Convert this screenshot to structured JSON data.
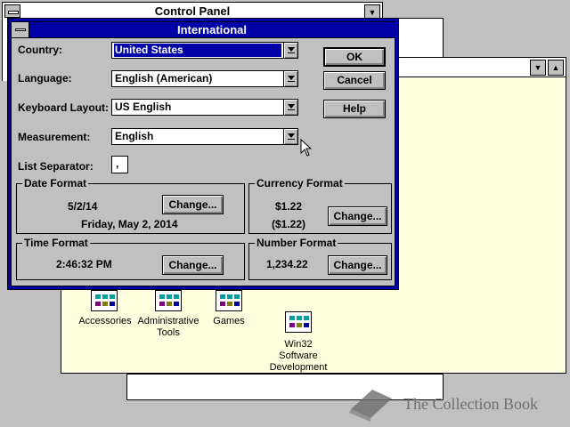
{
  "control_panel": {
    "title": "Control Panel"
  },
  "group_window": {
    "icons": [
      {
        "label": "Accessories"
      },
      {
        "label": "Administrative Tools"
      },
      {
        "label": "Games"
      },
      {
        "label": "Win32 Software Development"
      }
    ]
  },
  "dialog": {
    "title": "International",
    "country_label": "Country:",
    "country_value": "United States",
    "language_label": "Language:",
    "language_value": "English (American)",
    "keyboard_label": "Keyboard Layout:",
    "keyboard_value": "US English",
    "measurement_label": "Measurement:",
    "measurement_value": "English",
    "list_separator_label": "List Separator:",
    "list_separator_value": ",",
    "ok_label": "OK",
    "cancel_label": "Cancel",
    "help_label": "Help",
    "date_format": {
      "title": "Date Format",
      "short": "5/2/14",
      "long": "Friday, May 2, 2014",
      "change_label": "Change..."
    },
    "currency_format": {
      "title": "Currency Format",
      "positive": "$1.22",
      "negative": "($1.22)",
      "change_label": "Change..."
    },
    "time_format": {
      "title": "Time Format",
      "value": "2:46:32 PM",
      "change_label": "Change..."
    },
    "number_format": {
      "title": "Number Format",
      "value": "1,234.22",
      "change_label": "Change..."
    }
  },
  "watermark": {
    "text": "The Collection Book"
  }
}
